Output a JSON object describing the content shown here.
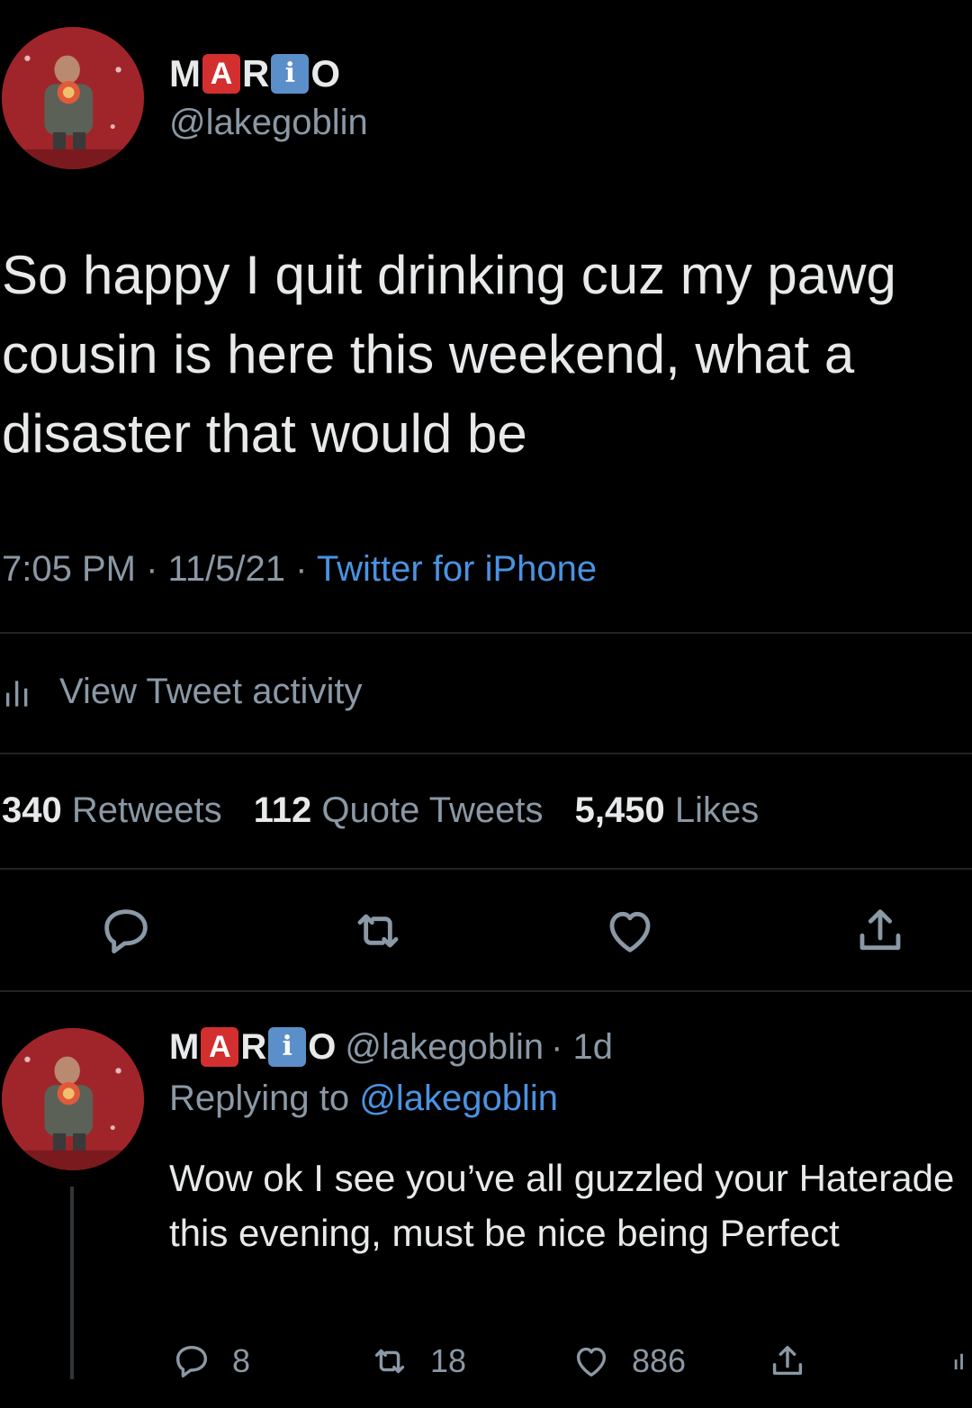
{
  "tweet": {
    "name_letters": [
      "M",
      "A",
      "R",
      "i",
      "O"
    ],
    "handle": "@lakegoblin",
    "text": "So happy I quit drinking cuz my pawg cousin is here this weekend, what a disaster that would be",
    "time": "7:05 PM",
    "date": "11/5/21",
    "source": "Twitter for iPhone",
    "separator": "·",
    "activity_label": "View Tweet activity",
    "stats": {
      "retweets_count": "340",
      "retweets_label": "Retweets",
      "quotes_count": "112",
      "quotes_label": "Quote Tweets",
      "likes_count": "5,450",
      "likes_label": "Likes"
    }
  },
  "reply": {
    "name_letters": [
      "M",
      "A",
      "R",
      "i",
      "O"
    ],
    "handle": "@lakegoblin",
    "age": "· 1d",
    "replying_prefix": "Replying to",
    "replying_to": "@lakegoblin",
    "text": "Wow ok I see you’ve all guzzled your Haterade this evening, must be nice being Perfect",
    "counts": {
      "replies": "8",
      "retweets": "18",
      "likes": "886"
    }
  },
  "icons": {
    "reply": "reply-icon",
    "retweet": "retweet-icon",
    "like": "heart-icon",
    "share": "share-icon",
    "activity": "bar-chart-icon"
  },
  "colors": {
    "background": "#000000",
    "text": "#e7e9ea",
    "secondary": "#8b98a5",
    "link": "#4a93e2",
    "emoji_a": "#d32f2f",
    "emoji_i": "#5b8fc9"
  }
}
